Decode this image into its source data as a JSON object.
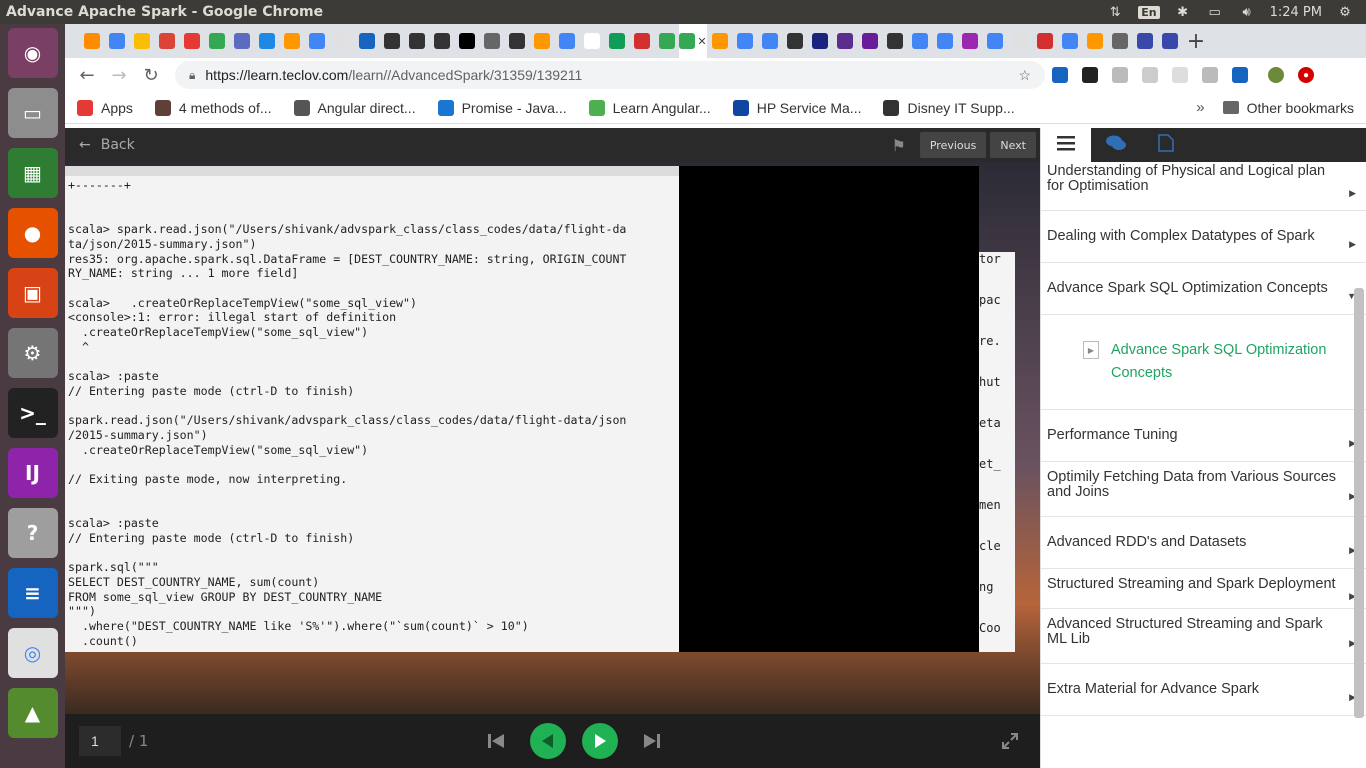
{
  "window": {
    "title": "Advance Apache Spark - Google Chrome",
    "time": "1:24 PM",
    "lang": "En"
  },
  "browser": {
    "url_host": "https://learn.teclov.com",
    "url_path": "/learn//AdvancedSpark/31359/139211",
    "tab_favicons": [
      "ff8c00",
      "4285f4",
      "fbbc04",
      "db4437",
      "e53935",
      "34a853",
      "5c6bc0",
      "1e88e5",
      "ff9800",
      "4285f4",
      "e0e0e0",
      "1565c0",
      "333333",
      "333333",
      "333333",
      "000000",
      "666666",
      "333333",
      "ff9800",
      "4285f4",
      "ffffff",
      "0f9d58",
      "d32f2f",
      "34a853",
      "34a853",
      "ff9800",
      "4285f4",
      "4285f4",
      "333333",
      "1a237e",
      "5c2d91",
      "6a1b9a",
      "333333",
      "4285f4",
      "4285f4",
      "9c27b0",
      "4285f4",
      "e0e0e0",
      "d32f2f",
      "4285f4",
      "ff9800",
      "666666",
      "3949ab",
      "3949ab"
    ],
    "bookmarks": [
      {
        "label": "Apps",
        "color": "#e53935"
      },
      {
        "label": "4 methods of...",
        "color": "#5d4037"
      },
      {
        "label": "Angular direct...",
        "color": "#555555"
      },
      {
        "label": "Promise - Java...",
        "color": "#1976d2"
      },
      {
        "label": "Learn Angular...",
        "color": "#4caf50"
      },
      {
        "label": "HP Service Ma...",
        "color": "#0d47a1"
      },
      {
        "label": "Disney IT Supp...",
        "color": "#333333"
      }
    ],
    "bookmarks_more": "»",
    "other_bookmarks": "Other bookmarks"
  },
  "player": {
    "back_label": "Back",
    "previous_label": "Previous",
    "next_label": "Next",
    "page_current": "1",
    "page_total": "/ 1"
  },
  "terminal_lines": [
    "+-------+",
    "",
    "",
    "scala> spark.read.json(\"/Users/shivank/advspark_class/class_codes/data/flight-da",
    "ta/json/2015-summary.json\")",
    "res35: org.apache.spark.sql.DataFrame = [DEST_COUNTRY_NAME: string, ORIGIN_COUNT",
    "RY_NAME: string ... 1 more field]",
    "",
    "scala>   .createOrReplaceTempView(\"some_sql_view\")",
    "<console>:1: error: illegal start of definition",
    "  .createOrReplaceTempView(\"some_sql_view\")",
    "  ^",
    "",
    "scala> :paste",
    "// Entering paste mode (ctrl-D to finish)",
    "",
    "spark.read.json(\"/Users/shivank/advspark_class/class_codes/data/flight-data/json",
    "/2015-summary.json\")",
    "  .createOrReplaceTempView(\"some_sql_view\")",
    "",
    "// Exiting paste mode, now interpreting.",
    "",
    "",
    "scala> :paste",
    "// Entering paste mode (ctrl-D to finish)",
    "",
    "spark.sql(\"\"\"",
    "SELECT DEST_COUNTRY_NAME, sum(count)",
    "FROM some_sql_view GROUP BY DEST_COUNTRY_NAME",
    "\"\"\")",
    "  .where(\"DEST_COUNTRY_NAME like 'S%'\").where(\"`sum(count)` > 10\")",
    "  .count()"
  ],
  "side_terminal_fragments": [
    "tor",
    "pac",
    "re.",
    "hut",
    "eta",
    "et_",
    "men",
    "cle",
    "ng",
    "Coo"
  ],
  "sections": [
    {
      "label": "Understanding of Physical and Logical plan for Optimisation",
      "expanded": false
    },
    {
      "label": "Dealing with Complex Datatypes of Spark",
      "expanded": false
    },
    {
      "label": "Advance Spark SQL Optimization Concepts",
      "expanded": true
    },
    {
      "label": "Performance Tuning",
      "expanded": false
    },
    {
      "label": "Optimily Fetching Data from Various Sources and Joins",
      "expanded": false
    },
    {
      "label": "Advanced RDD's and Datasets",
      "expanded": false
    },
    {
      "label": "Structured Streaming and Spark Deployment",
      "expanded": false
    },
    {
      "label": "Advanced Structured Streaming and Spark ML Lib",
      "expanded": false
    },
    {
      "label": "Extra Material for Advance Spark",
      "expanded": false
    }
  ],
  "active_lesson": "Advance Spark SQL Optimization Concepts",
  "colors": {
    "accent_green": "#1fa463",
    "play_green": "#1fb153"
  }
}
